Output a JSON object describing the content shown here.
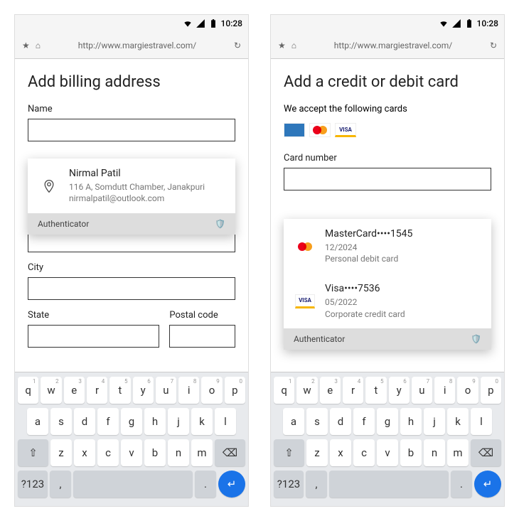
{
  "status": {
    "time": "10:28"
  },
  "addrbar": {
    "url": "http://www.margiestravel.com/"
  },
  "left": {
    "title": "Add billing address",
    "fields": {
      "name": "Name",
      "city": "City",
      "state": "State",
      "postal": "Postal code"
    },
    "suggestion": {
      "name": "Nirmal Patil",
      "addr": "116 A, Somdutt Chamber, Janakpuri",
      "email": "nirmalpatil@outlook.com"
    },
    "auth": "Authenticator"
  },
  "right": {
    "title": "Add a credit or debit card",
    "subtitle": "We accept the following cards",
    "visa_label": "VISA",
    "cardnum_label": "Card number",
    "suggestions": [
      {
        "brand": "mc",
        "title": "MasterCard••••1545",
        "exp": "12/2024",
        "desc": "Personal debit card"
      },
      {
        "brand": "visa",
        "title": "Visa••••7536",
        "exp": "05/2022",
        "desc": "Corporate credit card"
      }
    ],
    "auth": "Authenticator"
  },
  "kb": {
    "r1": [
      "q",
      "w",
      "e",
      "r",
      "t",
      "y",
      "u",
      "i",
      "o",
      "p"
    ],
    "r1h": [
      "1",
      "2",
      "3",
      "4",
      "5",
      "6",
      "7",
      "8",
      "9",
      "0"
    ],
    "r2": [
      "a",
      "s",
      "d",
      "f",
      "g",
      "h",
      "j",
      "k",
      "l"
    ],
    "r3": [
      "z",
      "x",
      "c",
      "v",
      "b",
      "n",
      "m"
    ],
    "sym": "?123",
    "comma": ",",
    "period": "."
  }
}
